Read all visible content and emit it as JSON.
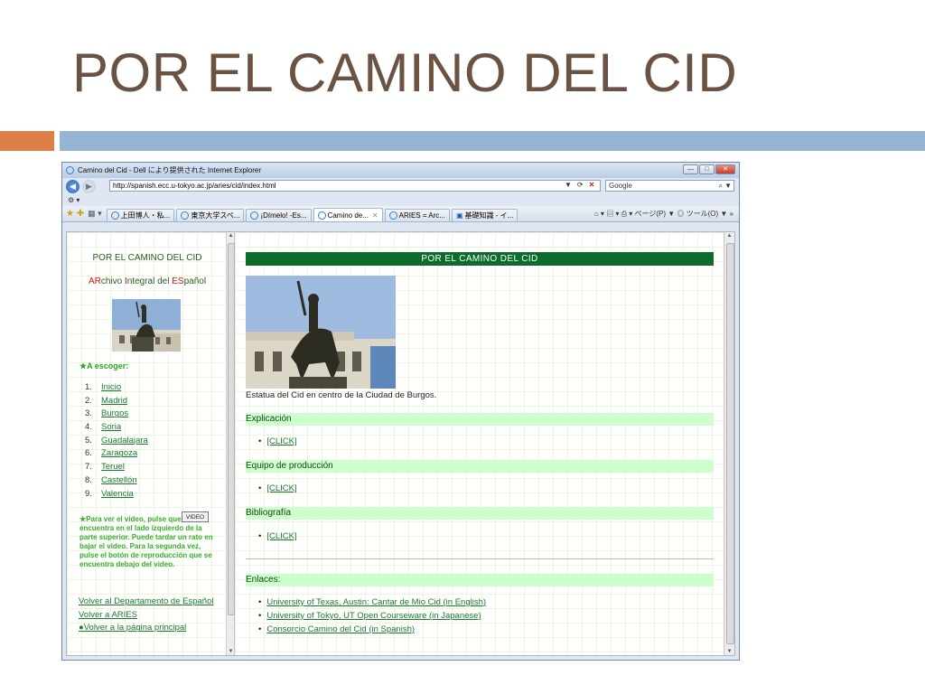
{
  "slide": {
    "title": "POR EL CAMINO DEL CID",
    "colors": {
      "title": "#6b5344",
      "orange_bar": "#dd8047",
      "blue_bar": "#94b6d2"
    }
  },
  "browser": {
    "window_title": "Camino del Cid - Dell により提供された Internet Explorer",
    "address": "http://spanish.ecc.u-tokyo.ac.jp/aries/cid/index.html",
    "search_placeholder": "Google",
    "tabs": [
      {
        "label": "上田博人・私..."
      },
      {
        "label": "東京大学スペ..."
      },
      {
        "label": "¡Dímelo! -Es..."
      },
      {
        "label": "Camino de...",
        "active": true
      },
      {
        "label": "ARIES = Arc..."
      },
      {
        "label": "基礎知識 - イ..."
      }
    ],
    "command_bar": "ページ(P) ▼ ◎ ツール(O) ▼ »",
    "icons": [
      "back-icon",
      "forward-icon",
      "refresh-icon",
      "stop-icon",
      "search-icon",
      "home-icon",
      "feeds-icon",
      "print-icon",
      "favorites-star-icon"
    ]
  },
  "left_frame": {
    "title": "POR EL CAMINO DEL CID",
    "archivo": {
      "p1": "AR",
      "p2": "chivo ",
      "p3": "I",
      "p4": "ntegral del ",
      "p5": "ES",
      "p6": "pañol"
    },
    "escoger": "★A escoger:",
    "list": [
      {
        "num": "1.",
        "label": "Inicio"
      },
      {
        "num": "2.",
        "label": "Madrid"
      },
      {
        "num": "3.",
        "label": "Burgos"
      },
      {
        "num": "4.",
        "label": "Soria"
      },
      {
        "num": "5.",
        "label": "Guadalajara"
      },
      {
        "num": "6.",
        "label": "Zaragoza"
      },
      {
        "num": "7.",
        "label": "Teruel"
      },
      {
        "num": "8.",
        "label": "Castellón"
      },
      {
        "num": "9.",
        "label": "Valencia"
      }
    ],
    "video_button": "VIDEO",
    "video_note": "★Para ver el video, pulse que se encuentra en el lado izquierdo de la parte superior. Puede tardar un rato en bajar el video. Para la segunda vez, pulse el botón de reproducción que se encuentra debajo del video.",
    "links": {
      "dept": "Volver al Departamento de Español",
      "aries": "Volver a ARIES",
      "main_dot": "●",
      "main": "Volver a la página principal"
    }
  },
  "right_frame": {
    "banner": "POR EL CAMINO DEL CID",
    "caption": "Estatua del Cid en centro de la Ciudad de Burgos.",
    "sections": {
      "explicacion": "Explicación",
      "equipo": "Equipo de producción",
      "bibliografia": "Bibliografía",
      "enlaces": "Enlaces:"
    },
    "click_label": "[CLICK]",
    "enlaces": [
      "University of Texas, Austin: Cantar de Mio Cid (in English)",
      "University of Tokyo, UT Open Courseware (in Japanese)",
      "Consorcio Camino del Cid (in Spanish)"
    ]
  }
}
